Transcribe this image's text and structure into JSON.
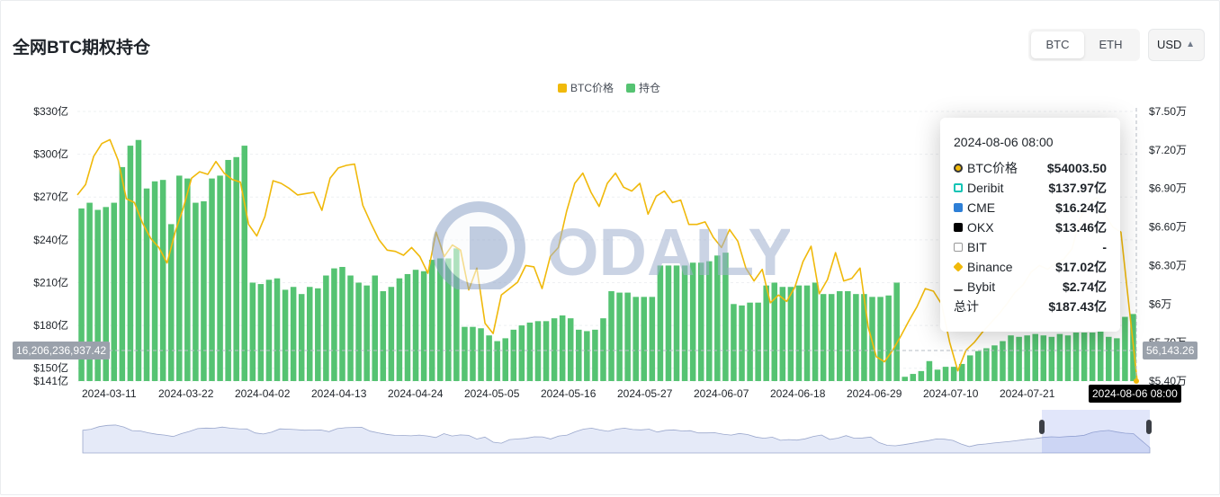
{
  "title": "全网BTC期权持仓",
  "asset_tabs": [
    {
      "label": "BTC",
      "active": true
    },
    {
      "label": "ETH",
      "active": false
    }
  ],
  "currency_select": {
    "value": "USD"
  },
  "colors": {
    "price": "#F0B90B",
    "open_interest": "#55C372",
    "accent_dark": "#1e2329"
  },
  "legend": [
    {
      "label": "BTC价格",
      "color": "#F0B90B"
    },
    {
      "label": "持仓",
      "color": "#55C372"
    }
  ],
  "crosshair": {
    "left_value_label": "16,206,236,937.42",
    "right_value_label": "56,143.26",
    "date_label": "2024-08-06 08:00"
  },
  "tooltip": {
    "date": "2024-08-06 08:00",
    "rows": [
      {
        "icon": "btc-price-icon",
        "name": "BTC价格",
        "value": "$54003.50"
      },
      {
        "icon": "deribit-icon",
        "name": "Deribit",
        "value": "$137.97亿"
      },
      {
        "icon": "cme-icon",
        "name": "CME",
        "value": "$16.24亿"
      },
      {
        "icon": "okx-icon",
        "name": "OKX",
        "value": "$13.46亿"
      },
      {
        "icon": "bit-icon",
        "name": "BIT",
        "value": "-"
      },
      {
        "icon": "binance-icon",
        "name": "Binance",
        "value": "$17.02亿"
      },
      {
        "icon": "bybit-icon",
        "name": "Bybit",
        "value": "$2.74亿"
      },
      {
        "icon": "total-icon",
        "name": "总计",
        "value": "$187.43亿"
      }
    ]
  },
  "watermark_text": "ODAILY",
  "chart_data": {
    "type": "bar",
    "title": "全网BTC期权持仓",
    "left_axis": {
      "ticks": [
        "$330亿",
        "$300亿",
        "$270亿",
        "$240亿",
        "$210亿",
        "$180亿",
        "$150亿",
        "$141亿"
      ],
      "tick_values": [
        330,
        300,
        270,
        240,
        210,
        180,
        150,
        141
      ],
      "ylim": [
        141,
        330
      ],
      "unit": "亿 USD"
    },
    "right_axis": {
      "ticks": [
        "$7.50万",
        "$7.20万",
        "$6.90万",
        "$6.60万",
        "$6.30万",
        "$6万",
        "$5.70万",
        "$5.40万"
      ],
      "tick_values": [
        75000,
        72000,
        69000,
        66000,
        63000,
        60000,
        57000,
        54000
      ],
      "ylim": [
        54000,
        75000
      ],
      "unit": "USD"
    },
    "x_ticks": [
      "2024-03-11",
      "2024-03-22",
      "2024-04-02",
      "2024-04-13",
      "2024-04-24",
      "2024-05-05",
      "2024-05-16",
      "2024-05-27",
      "2024-06-07",
      "2024-06-18",
      "2024-06-29",
      "2024-07-10",
      "2024-07-21"
    ],
    "x_range": [
      "2024-03-08",
      "2024-08-06"
    ],
    "grid": true,
    "legend_position": "top-center",
    "series": [
      {
        "name": "持仓",
        "type": "bar",
        "axis": "left",
        "values": [
          262,
          266,
          261,
          263,
          266,
          291,
          306,
          310,
          276,
          281,
          282,
          251,
          285,
          283,
          266,
          267,
          283,
          285,
          296,
          298,
          306,
          210,
          209,
          212,
          213,
          205,
          207,
          202,
          207,
          206,
          215,
          220,
          221,
          215,
          210,
          208,
          215,
          204,
          207,
          213,
          216,
          219,
          218,
          226,
          227,
          227,
          234,
          179,
          179,
          178,
          173,
          169,
          171,
          177,
          180,
          182,
          183,
          183,
          185,
          187,
          185,
          177,
          176,
          177,
          185,
          204,
          203,
          203,
          200,
          200,
          200,
          222,
          222,
          222,
          222,
          224,
          224,
          225,
          229,
          231,
          195,
          194,
          196,
          196,
          208,
          210,
          207,
          207,
          208,
          208,
          210,
          202,
          202,
          204,
          204,
          202,
          202,
          200,
          200,
          201,
          210,
          144,
          146,
          148,
          155,
          149,
          151,
          151,
          153,
          159,
          162,
          164,
          166,
          169,
          173,
          172,
          173,
          174,
          173,
          172,
          174,
          173,
          175,
          175,
          175,
          176,
          172,
          171,
          186,
          188
        ]
      },
      {
        "name": "BTC价格",
        "type": "line",
        "axis": "right",
        "values": [
          68500,
          69300,
          71500,
          72500,
          72800,
          71200,
          68200,
          67900,
          66300,
          65100,
          64400,
          63200,
          65600,
          67500,
          69800,
          70300,
          70100,
          71100,
          70200,
          69700,
          69500,
          66200,
          65300,
          66800,
          69600,
          69400,
          69000,
          68500,
          68600,
          68700,
          67300,
          69800,
          70600,
          70800,
          70900,
          67700,
          66300,
          65000,
          64200,
          64100,
          63800,
          64400,
          63700,
          62400,
          65600,
          63700,
          64600,
          64200,
          61100,
          62800,
          58500,
          57700,
          60700,
          61200,
          61700,
          63000,
          62900,
          61200,
          63700,
          64400,
          67200,
          69400,
          70200,
          68700,
          67600,
          69400,
          70200,
          69100,
          68800,
          69400,
          67000,
          68400,
          68800,
          67900,
          68100,
          66200,
          66200,
          66400,
          65200,
          64400,
          65800,
          64900,
          62800,
          61800,
          62700,
          60100,
          60700,
          60200,
          61300,
          63300,
          64500,
          60800,
          61900,
          64000,
          61800,
          62000,
          62800,
          58200,
          55900,
          55500,
          56400,
          57500,
          58700,
          59800,
          61200,
          61000,
          60000,
          57000,
          54800,
          56400,
          57000,
          57800,
          58500,
          59200,
          60000,
          60900,
          61500,
          62500,
          63000,
          62700,
          63200,
          63500,
          64300,
          66700,
          67800,
          68300,
          67000,
          66000,
          65600,
          59800,
          54003
        ]
      }
    ]
  }
}
